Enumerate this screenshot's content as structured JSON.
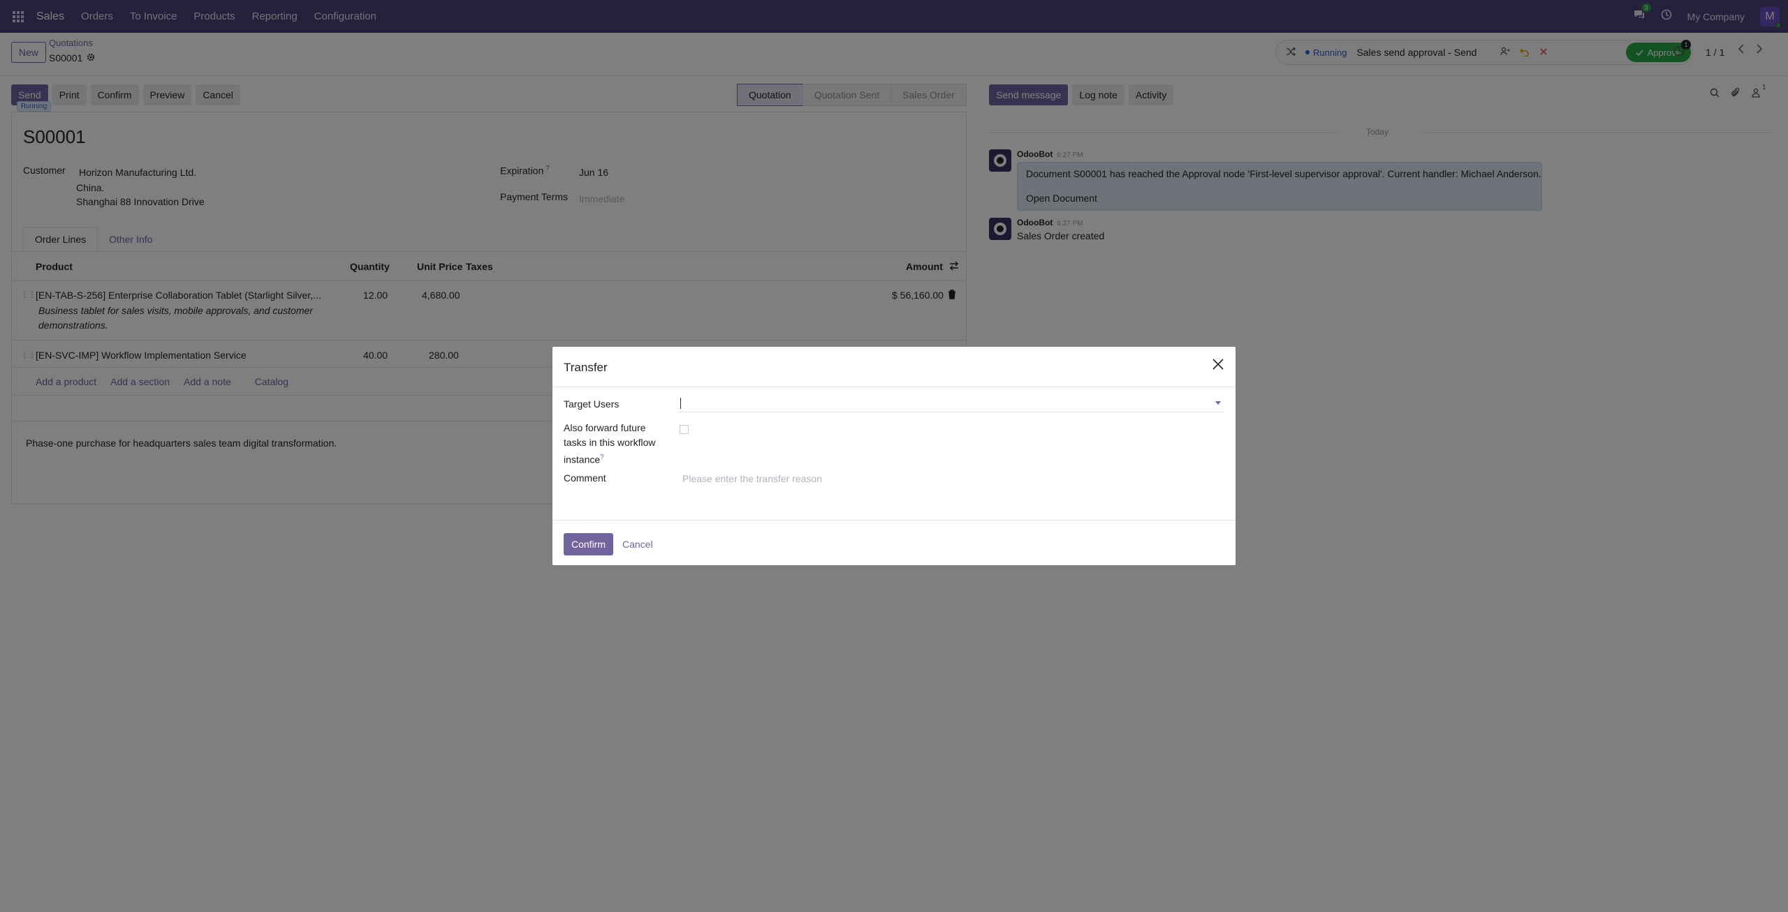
{
  "navbar": {
    "app_name": "Sales",
    "menu": [
      "Orders",
      "To Invoice",
      "Products",
      "Reporting",
      "Configuration"
    ],
    "messages_count": "3",
    "company": "My Company",
    "user_initial": "M"
  },
  "control": {
    "new_label": "New",
    "breadcrumb_parent": "Quotations",
    "record_name": "S00001",
    "workflow": {
      "status": "Running",
      "title": "Sales send approval - Send",
      "approve_label": "Approve"
    },
    "activity_badge": "1",
    "pager": "1 / 1"
  },
  "actions": {
    "send": "Send",
    "running_tip": "Running",
    "print": "Print",
    "confirm": "Confirm",
    "preview": "Preview",
    "cancel": "Cancel"
  },
  "stages": [
    "Quotation",
    "Quotation Sent",
    "Sales Order"
  ],
  "form": {
    "title": "S00001",
    "customer_label": "Customer",
    "customer_name": "Horizon Manufacturing Ltd.",
    "customer_addr1": "China.",
    "customer_addr2": "Shanghai 88 Innovation Drive",
    "expiration_label": "Expiration",
    "expiration_value": "Jun 16",
    "payment_terms_label": "Payment Terms",
    "payment_terms_placeholder": "Immediate",
    "tabs": [
      "Order Lines",
      "Other Info"
    ],
    "columns": {
      "product": "Product",
      "quantity": "Quantity",
      "unit_price": "Unit Price",
      "taxes": "Taxes",
      "amount": "Amount"
    },
    "lines": [
      {
        "product": "[EN-TAB-S-256] Enterprise Collaboration Tablet (Starlight Silver,...",
        "description": "Business tablet for sales visits, mobile approvals, and customer demonstrations.",
        "quantity": "12.00",
        "unit_price": "4,680.00",
        "amount": "$ 56,160.00"
      },
      {
        "product": "[EN-SVC-IMP] Workflow Implementation Service",
        "quantity": "40.00",
        "unit_price": "280.00"
      }
    ],
    "add_links": [
      "Add a product",
      "Add a section",
      "Add a note",
      "Catalog"
    ],
    "note": "Phase-one purchase for headquarters sales team digital transformation."
  },
  "chatter": {
    "send_message": "Send message",
    "log_note": "Log note",
    "activity": "Activity",
    "followers_count": "1",
    "date_separator": "Today",
    "messages": [
      {
        "author": "OdooBot",
        "time": "6:27 PM",
        "body": "Document S00001 has reached the Approval node 'First-level supervisor approval'. Current handler: Michael Anderson.",
        "link": "Open Document"
      },
      {
        "author": "OdooBot",
        "time": "6:27 PM",
        "body": "Sales Order created"
      }
    ]
  },
  "modal": {
    "title": "Transfer",
    "target_users_label": "Target Users",
    "forward_label_1": "Also forward future",
    "forward_label_2": "tasks in this workflow",
    "forward_label_3": "instance",
    "help_mark": "?",
    "comment_label": "Comment",
    "comment_placeholder": "Please enter the transfer reason",
    "confirm_label": "Confirm",
    "cancel_label": "Cancel"
  },
  "colors": {
    "brand": "#71639e",
    "navbar": "#4a4179",
    "approve": "#28a745",
    "running": "#2e5bd1"
  }
}
